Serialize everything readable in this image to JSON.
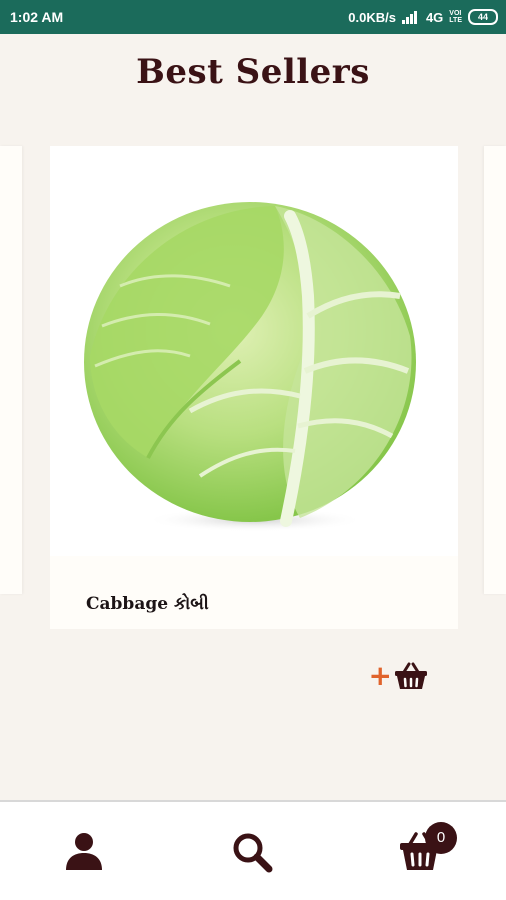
{
  "status_bar": {
    "time": "1:02 AM",
    "network_speed": "0.0KB/s",
    "network_type": "4G",
    "volte_line1": "VOI",
    "volte_line2": "LTE",
    "battery": "44"
  },
  "page": {
    "title": "Best Sellers"
  },
  "product": {
    "name": "Cabbage કોબી",
    "image_icon": "cabbage-image"
  },
  "actions": {
    "add_icon": "plus-icon",
    "basket_icon": "basket-icon"
  },
  "bottom_nav": {
    "items": [
      {
        "icon": "user-icon"
      },
      {
        "icon": "search-icon"
      },
      {
        "icon": "cart-icon"
      }
    ],
    "cart_count": "0"
  },
  "colors": {
    "status_bar": "#1b6b5b",
    "title": "#3a1215",
    "accent": "#e0632c",
    "icon": "#3a1215",
    "background": "#f7f3ee"
  }
}
